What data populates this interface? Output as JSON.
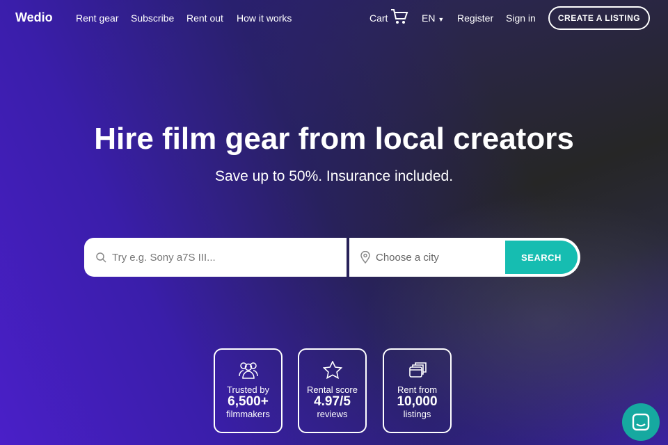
{
  "nav": {
    "logo": "Wedio",
    "links": [
      "Rent gear",
      "Subscribe",
      "Rent out",
      "How it works"
    ],
    "cart": "Cart",
    "lang": "EN",
    "register": "Register",
    "signin": "Sign in",
    "create": "CREATE A LISTING"
  },
  "hero": {
    "title": "Hire film gear from local creators",
    "subtitle": "Save up to 50%. Insurance included."
  },
  "search": {
    "placeholder": "Try e.g. Sony a7S III...",
    "city_placeholder": "Choose a city",
    "button": "SEARCH"
  },
  "stats": [
    {
      "top": "Trusted by",
      "value": "6,500+",
      "bottom": "filmmakers"
    },
    {
      "top": "Rental score",
      "value": "4.97/5",
      "bottom": "reviews"
    },
    {
      "top": "Rent from",
      "value": "10,000",
      "bottom": "listings"
    }
  ]
}
